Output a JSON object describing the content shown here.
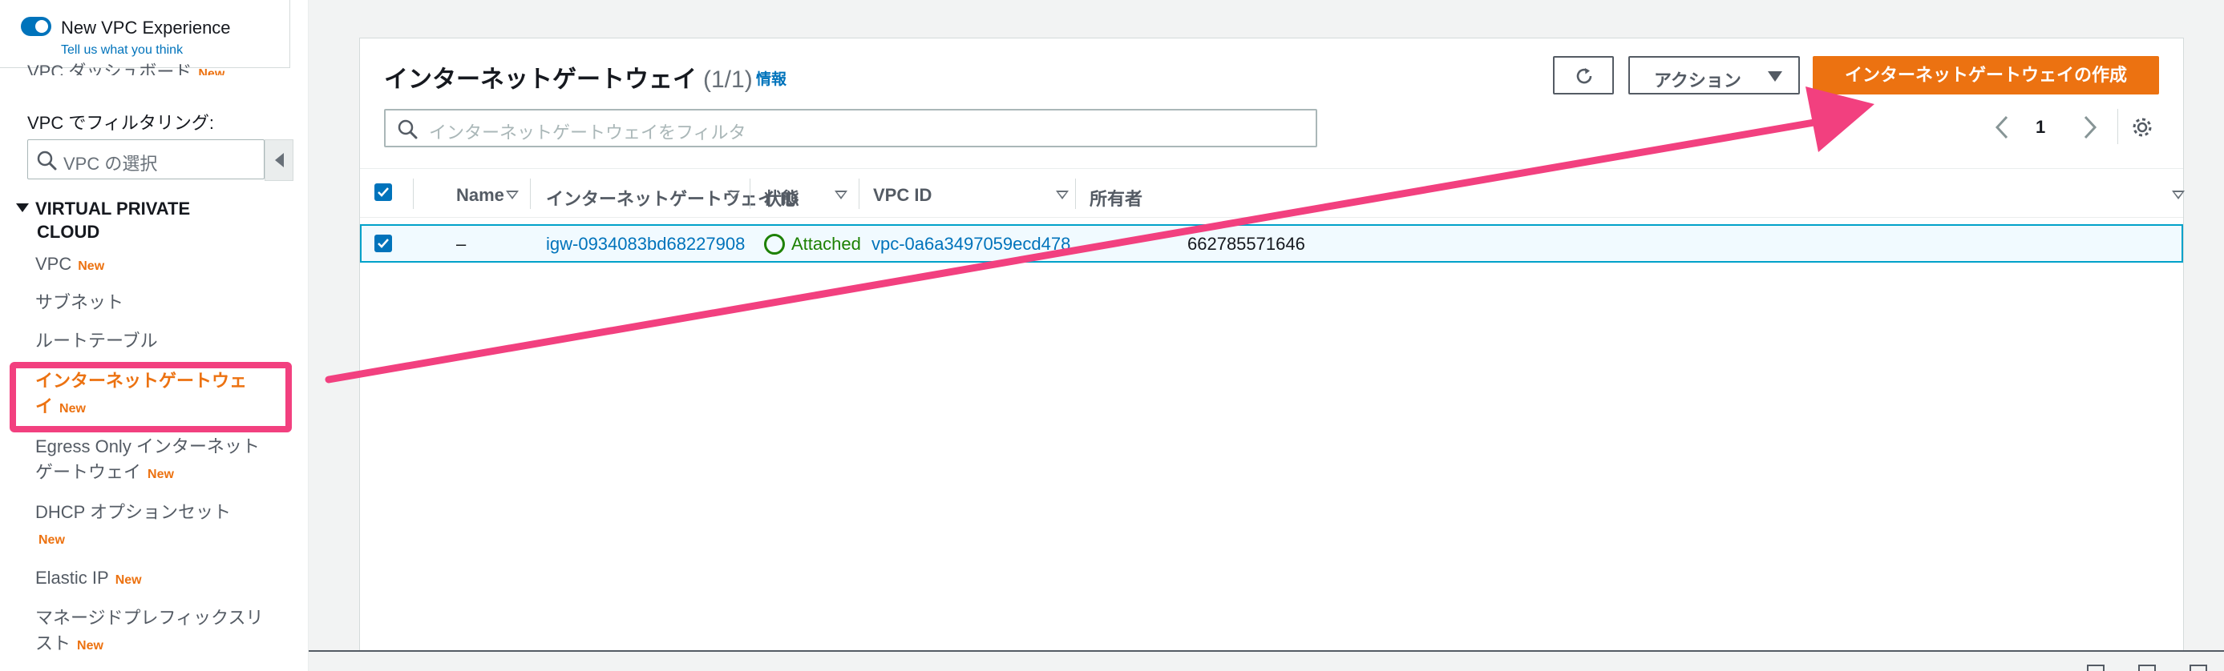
{
  "sidebar": {
    "experience_toggle_label": "New VPC Experience",
    "experience_feedback_link": "Tell us what you think",
    "peek_item_label": "VPC ダッシュボード",
    "filter_label": "VPC でフィルタリング:",
    "filter_placeholder": "VPC の選択",
    "section_title_line1": "VIRTUAL PRIVATE",
    "section_title_line2": "CLOUD",
    "new_badge": "New",
    "items": [
      {
        "label": "VPC",
        "new": true
      },
      {
        "label": "サブネット",
        "new": false
      },
      {
        "label": "ルートテーブル",
        "new": false
      },
      {
        "label_line1": "インターネットゲートウェ",
        "label_line2": "イ",
        "new": true,
        "active": true
      },
      {
        "label_line1": "Egress Only インターネット",
        "label_line2": "ゲートウェイ",
        "new": true
      },
      {
        "label_line1": "DHCP オプションセット",
        "label_line2": "",
        "new": true
      },
      {
        "label": "Elastic IP",
        "new": true
      },
      {
        "label_line1": "マネージドプレフィックスリ",
        "label_line2": "スト",
        "new": true
      }
    ]
  },
  "panel": {
    "title": "インターネットゲートウェイ",
    "count": "(1/1)",
    "info_link": "情報",
    "actions_label": "アクション",
    "create_button": "インターネットゲートウェイの作成",
    "search_placeholder": "インターネットゲートウェイをフィルタ",
    "page_number": "1"
  },
  "table": {
    "columns": [
      "Name",
      "インターネットゲートウェイ ID",
      "状態",
      "VPC ID",
      "所有者"
    ],
    "rows": [
      {
        "selected": true,
        "name": "–",
        "igw_id": "igw-0934083bd68227908",
        "state": "Attached",
        "vpc_id": "vpc-0a6a3497059ecd478",
        "owner": "662785571646"
      }
    ]
  },
  "colors": {
    "accent_orange": "#ec7211",
    "link_blue": "#0073bb",
    "annotation_pink": "#f2407f",
    "status_green": "#1d8102"
  }
}
